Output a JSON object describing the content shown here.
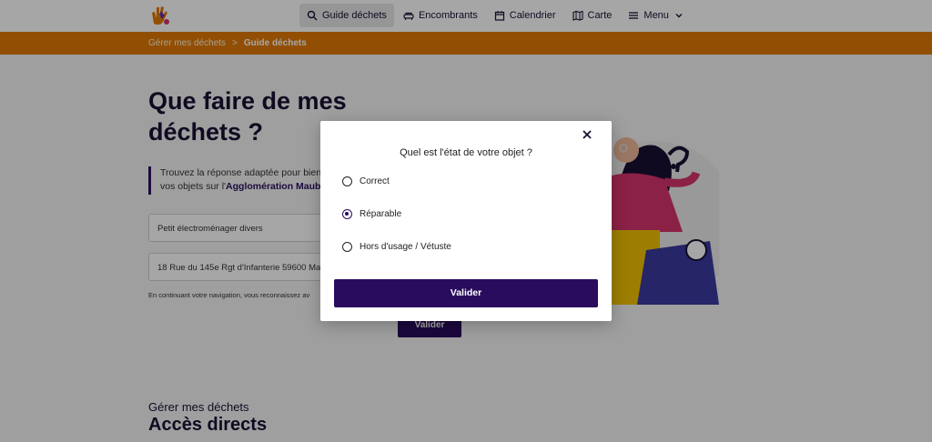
{
  "nav": {
    "items": [
      {
        "label": "Guide déchets",
        "icon": "search-icon",
        "active": true
      },
      {
        "label": "Encombrants",
        "icon": "couch-icon"
      },
      {
        "label": "Calendrier",
        "icon": "calendar-icon"
      },
      {
        "label": "Carte",
        "icon": "map-icon"
      },
      {
        "label": "Menu",
        "icon": "menu-icon"
      }
    ]
  },
  "breadcrumb": {
    "parent": "Gérer mes déchets",
    "separator": ">",
    "current": "Guide déchets"
  },
  "page": {
    "title": "Que faire de mes déchets ?",
    "intro_prefix": "Trouvez la réponse adaptée pour bien",
    "intro_line2": "vos objets sur l'",
    "intro_strong": "Agglomération Maub",
    "field_object": "Petit électroménager divers",
    "field_address": "18 Rue du 145e Rgt d'Infanterie 59600 Ma",
    "disclaimer": "En continuant votre navigation, vous reconnaissez av",
    "validate_label": "Valider",
    "section_subtitle": "Gérer mes déchets",
    "section_title": "Accès directs"
  },
  "modal": {
    "question": "Quel est l'état de votre objet ?",
    "options": [
      {
        "label": "Correct",
        "selected": false
      },
      {
        "label": "Réparable",
        "selected": true
      },
      {
        "label": "Hors d'usage / Vétuste",
        "selected": false
      }
    ],
    "validate_label": "Valider",
    "close_icon": "close-icon"
  },
  "colors": {
    "accent_orange": "#e07a06",
    "primary_purple": "#2a0c5e"
  }
}
